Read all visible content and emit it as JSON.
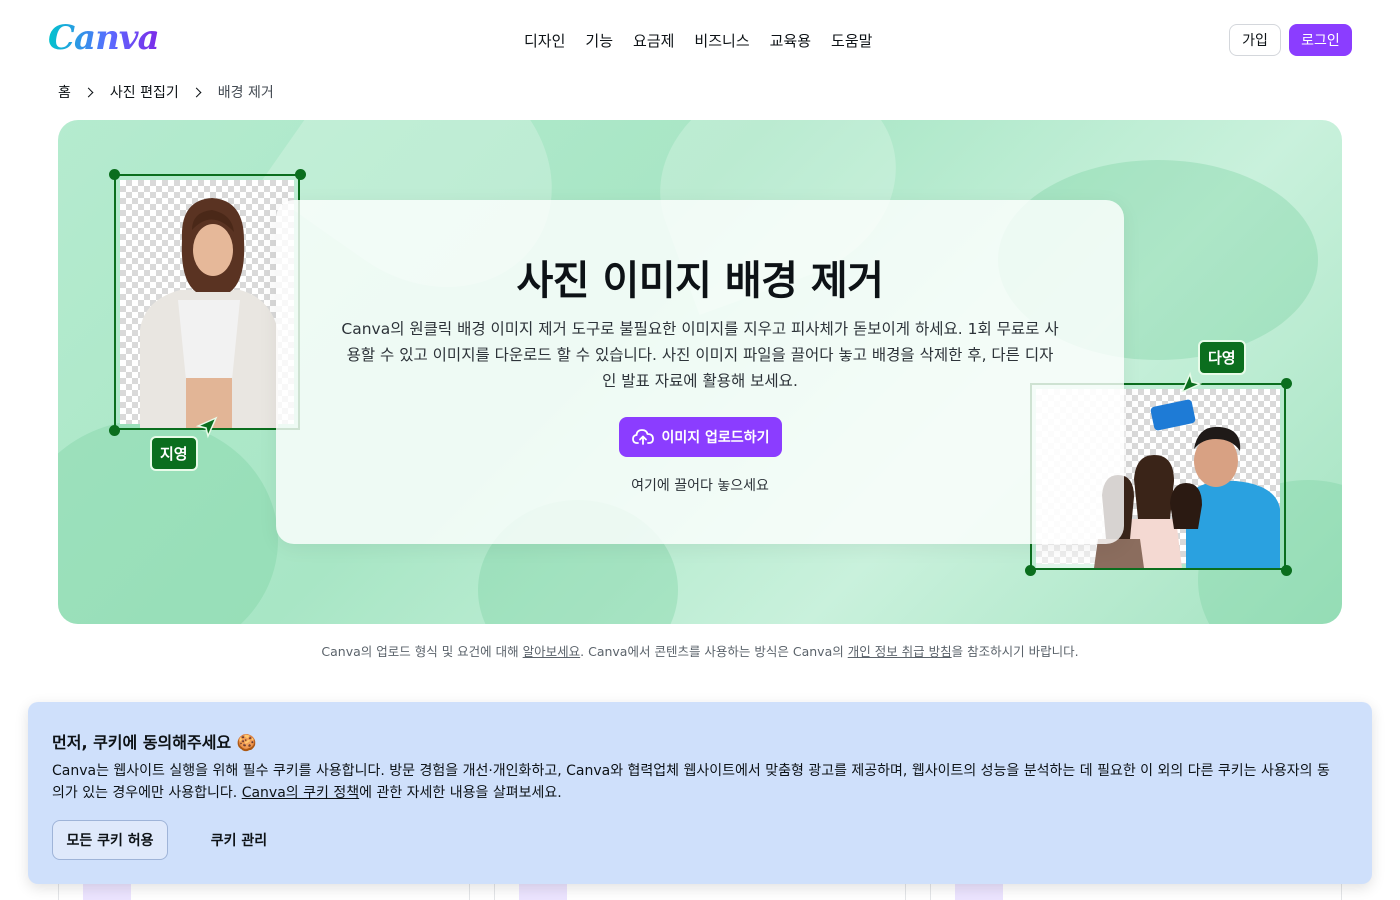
{
  "header": {
    "logo": "Canva",
    "nav": [
      "디자인",
      "기능",
      "요금제",
      "비즈니스",
      "교육용",
      "도움말"
    ],
    "signup_label": "가입",
    "login_label": "로그인"
  },
  "breadcrumb": {
    "items": [
      "홈",
      "사진 편집기",
      "배경 제거"
    ]
  },
  "hero": {
    "title": "사진 이미지 배경 제거",
    "description": "Canva의 원클릭 배경 이미지 제거 도구로 불필요한 이미지를 지우고 피사체가 돋보이게 하세요. 1회 무료로 사용할 수 있고 이미지를 다운로드 할 수 있습니다. 사진 이미지 파일을 끌어다 놓고 배경을 삭제한 후, 다른 디자인 발표 자료에 활용해 보세요.",
    "upload_label": "이미지 업로드하기",
    "drop_text": "여기에 끌어다 놓으세요",
    "tag_left": "지영",
    "tag_right": "다영"
  },
  "footnote": {
    "part1": "Canva의 업로드 형식 및 요건에 대해 ",
    "link1": "알아보세요",
    "part2": ". Canva에서 콘텐츠를 사용하는 방식은 Canva의 ",
    "link2": "개인 정보 취급 방침",
    "part3": "을 참조하시기 바랍니다."
  },
  "cookie": {
    "title": "먼저, 쿠키에 동의해주세요 🍪",
    "text_part1": "Canva는 웹사이트 실행을 위해 필수 쿠키를 사용합니다. 방문 경험을 개선·개인화하고, Canva와 협력업체 웹사이트에서 맞춤형 광고를 제공하며, 웹사이트의 성능을 분석하는 데 필요한 이 외의 다른 쿠키는 사용자의 동의가 있는 경우에만 사용합니다. ",
    "text_link": "Canva의 쿠키 정책",
    "text_part2": "에 관한 자세한 내용을 살펴보세요.",
    "accept_label": "모든 쿠키 허용",
    "manage_label": "쿠키 관리"
  },
  "colors": {
    "brand_purple": "#8b3dff",
    "frame_green": "#0b6e1e",
    "cookie_bg": "#cfe0fb"
  }
}
